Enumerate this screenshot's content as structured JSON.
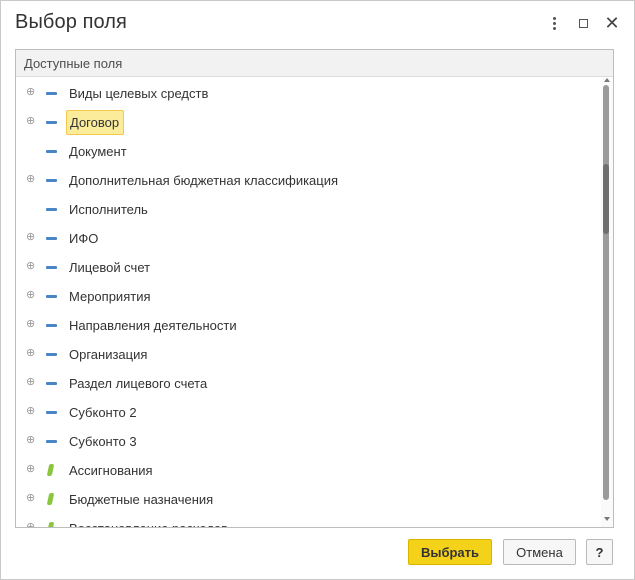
{
  "window": {
    "title": "Выбор поля",
    "controls": {
      "more_icon": "more-vertical-icon",
      "maximize_icon": "maximize-icon",
      "close_icon": "close-icon"
    }
  },
  "list": {
    "header": "Доступные поля",
    "items": [
      {
        "label": "Виды целевых средств",
        "expandable": true,
        "icon": "field-dash-icon",
        "selected": false
      },
      {
        "label": "Договор",
        "expandable": true,
        "icon": "field-dash-icon",
        "selected": true
      },
      {
        "label": "Документ",
        "expandable": false,
        "icon": "field-dash-icon",
        "selected": false
      },
      {
        "label": "Дополнительная бюджетная классификация",
        "expandable": true,
        "icon": "field-dash-icon",
        "selected": false
      },
      {
        "label": "Исполнитель",
        "expandable": false,
        "icon": "field-dash-icon",
        "selected": false
      },
      {
        "label": "ИФО",
        "expandable": true,
        "icon": "field-dash-icon",
        "selected": false
      },
      {
        "label": "Лицевой счет",
        "expandable": true,
        "icon": "field-dash-icon",
        "selected": false
      },
      {
        "label": "Мероприятия",
        "expandable": true,
        "icon": "field-dash-icon",
        "selected": false
      },
      {
        "label": "Направления деятельности",
        "expandable": true,
        "icon": "field-dash-icon",
        "selected": false
      },
      {
        "label": "Организация",
        "expandable": true,
        "icon": "field-dash-icon",
        "selected": false
      },
      {
        "label": "Раздел лицевого счета",
        "expandable": true,
        "icon": "field-dash-icon",
        "selected": false
      },
      {
        "label": "Субконто 2",
        "expandable": true,
        "icon": "field-dash-icon",
        "selected": false
      },
      {
        "label": "Субконто 3",
        "expandable": true,
        "icon": "field-dash-icon",
        "selected": false
      },
      {
        "label": "Ассигнования",
        "expandable": true,
        "icon": "resource-green-icon",
        "selected": false
      },
      {
        "label": "Бюджетные назначения",
        "expandable": true,
        "icon": "resource-green-icon",
        "selected": false
      },
      {
        "label": "Восстановление расходов",
        "expandable": true,
        "icon": "resource-green-icon",
        "selected": false
      }
    ]
  },
  "buttons": {
    "select": "Выбрать",
    "cancel": "Отмена",
    "help": "?"
  },
  "colors": {
    "primary_button": "#f5d21a",
    "selection": "#fbec9b",
    "dimension_icon": "#4a86c5",
    "resource_icon": "#8cc63f"
  }
}
